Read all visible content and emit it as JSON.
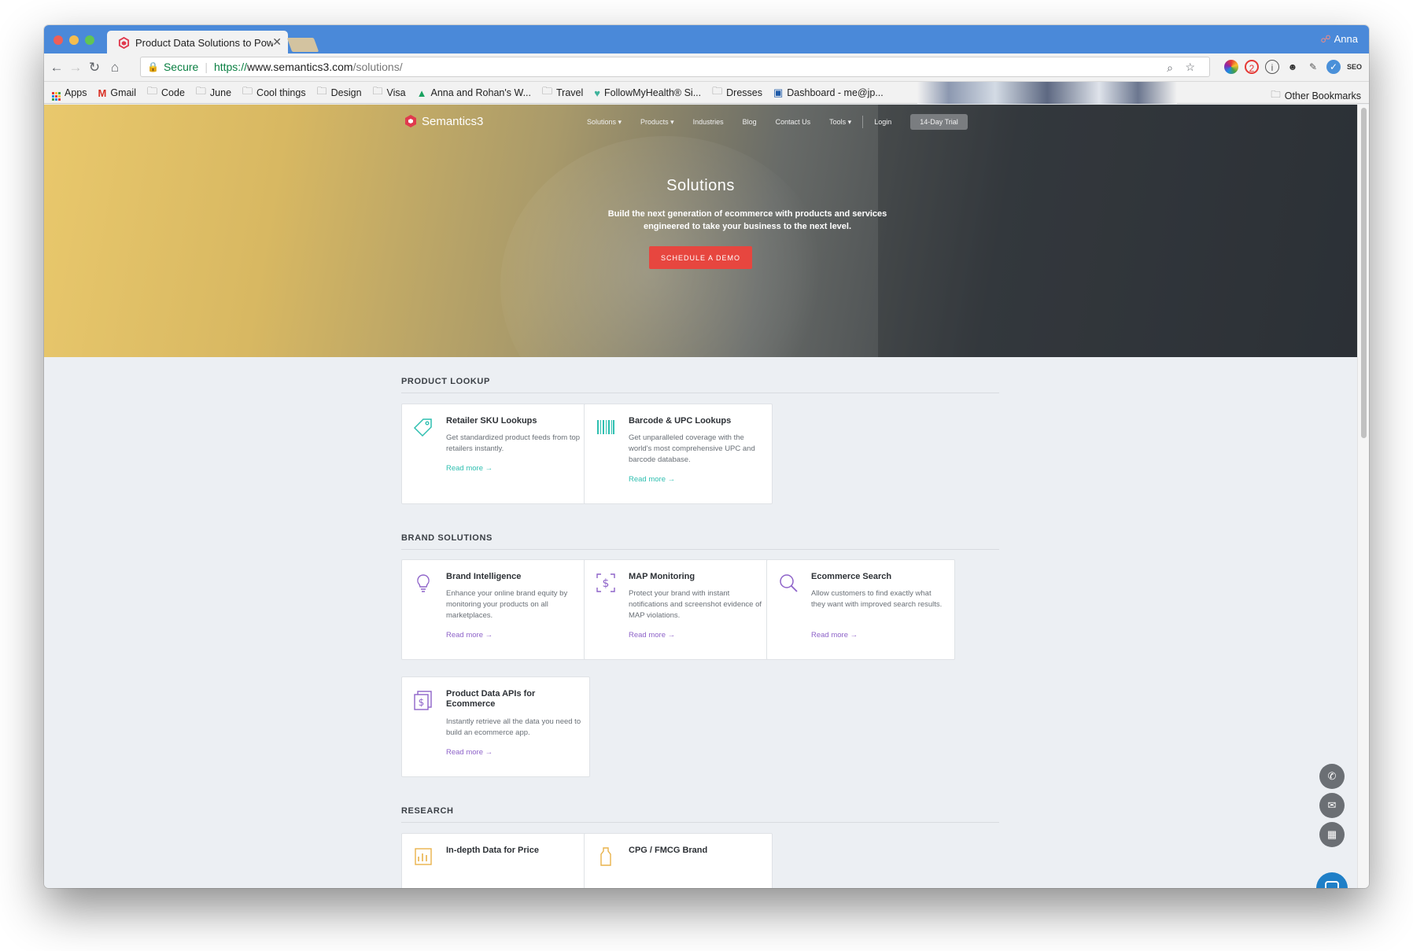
{
  "browser": {
    "tab_title": "Product Data Solutions to Pow",
    "user_name": "Anna",
    "omnibox": {
      "secure_label": "Secure",
      "protocol": "https://",
      "host": "www.semantics3.com",
      "path": "/solutions/"
    },
    "bookmarks": [
      {
        "label": "Apps",
        "icon": "apps-grid-icon"
      },
      {
        "label": "Gmail",
        "icon": "gmail-icon"
      },
      {
        "label": "Code",
        "icon": "folder-icon"
      },
      {
        "label": "June",
        "icon": "folder-icon"
      },
      {
        "label": "Cool things",
        "icon": "folder-icon"
      },
      {
        "label": "Design",
        "icon": "folder-icon"
      },
      {
        "label": "Visa",
        "icon": "folder-icon"
      },
      {
        "label": "Anna and Rohan's W...",
        "icon": "drive-icon"
      },
      {
        "label": "Travel",
        "icon": "folder-icon"
      },
      {
        "label": "FollowMyHealth® Si...",
        "icon": "heart-icon"
      },
      {
        "label": "Dresses",
        "icon": "folder-icon"
      },
      {
        "label": "Dashboard - me@jp...",
        "icon": "dashboard-icon"
      }
    ],
    "other_bookmarks": "Other Bookmarks"
  },
  "site": {
    "logo_text": "Semantics3",
    "nav": [
      "Solutions ▾",
      "Products ▾",
      "Industries",
      "Blog",
      "Contact Us",
      "Tools ▾"
    ],
    "login": "Login",
    "trial": "14-Day Trial",
    "hero": {
      "title": "Solutions",
      "subtitle": "Build the next generation of ecommerce with products and services engineered to take your business to the next level.",
      "cta": "SCHEDULE A DEMO"
    },
    "sections": {
      "lookup": {
        "title": "PRODUCT LOOKUP",
        "cards": [
          {
            "title": "Retailer SKU Lookups",
            "desc": "Get standardized product feeds from top retailers instantly.",
            "link": "Read more →",
            "icon": "tag-icon"
          },
          {
            "title": "Barcode & UPC Lookups",
            "desc": "Get unparalleled coverage with the world's most comprehensive UPC and barcode database.",
            "link": "Read more →",
            "icon": "barcode-icon"
          }
        ]
      },
      "brand": {
        "title": "BRAND SOLUTIONS",
        "cards": [
          {
            "title": "Brand Intelligence",
            "desc": "Enhance your online brand equity by monitoring your products on all marketplaces.",
            "link": "Read more →",
            "icon": "lightbulb-icon"
          },
          {
            "title": "MAP Monitoring",
            "desc": "Protect your brand with instant notifications and screenshot evidence of MAP violations.",
            "link": "Read more →",
            "icon": "dollar-frame-icon"
          },
          {
            "title": "Ecommerce Search",
            "desc": "Allow customers to find exactly what they want with improved search results.",
            "link": "Read more →",
            "icon": "magnifier-icon"
          },
          {
            "title": "Product Data APIs for Ecommerce",
            "desc": "Instantly retrieve all the data you need to build an ecommerce app.",
            "link": "Read more →",
            "icon": "dollar-document-icon"
          }
        ]
      },
      "research": {
        "title": "RESEARCH",
        "cards": [
          {
            "title": "In-depth Data for Price",
            "icon": "chart-icon"
          },
          {
            "title": "CPG / FMCG Brand",
            "icon": "bottle-icon"
          }
        ]
      }
    },
    "colors": {
      "teal": "#2fbfb0",
      "purple": "#8e63c9",
      "red_cta": "#e7463f",
      "amber": "#e9b24a"
    }
  }
}
